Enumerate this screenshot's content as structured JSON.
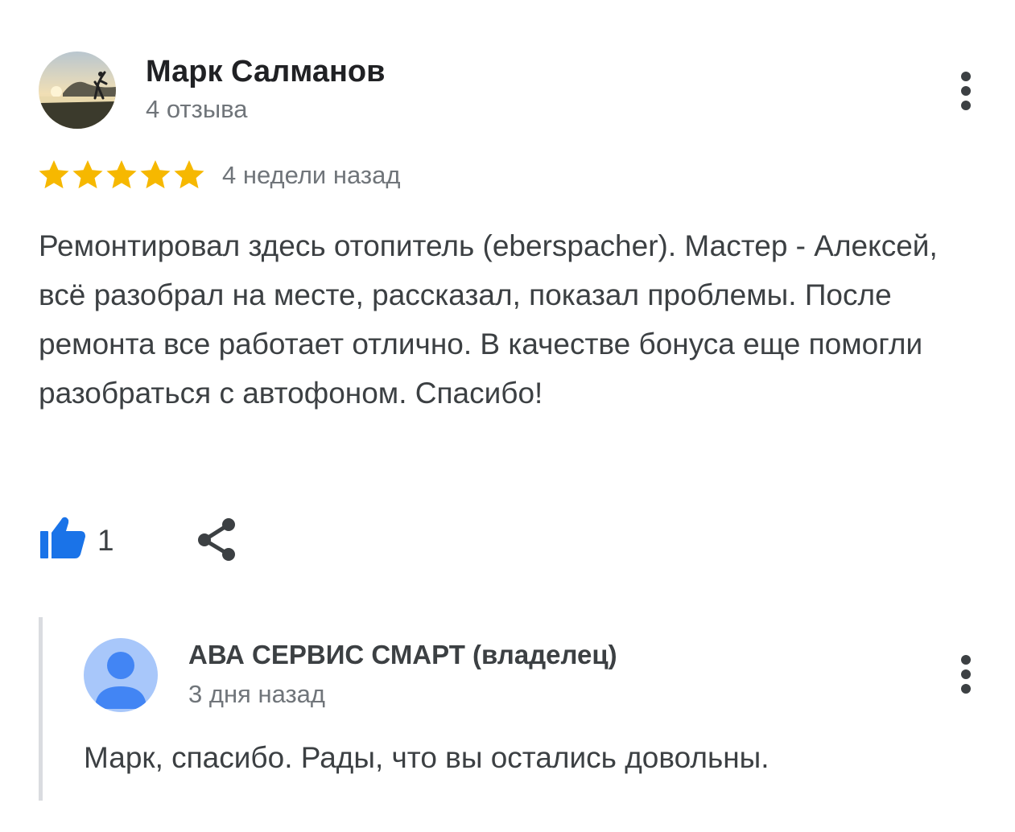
{
  "review": {
    "author": {
      "name": "Марк Салманов",
      "review_count": "4 отзыва",
      "avatar_icon": "user-photo-avatar"
    },
    "rating": 5,
    "rating_max": 5,
    "star_color": "#f6b800",
    "date": "4 недели назад",
    "text": "Ремонтировал здесь отопитель (eberspacher). Мастер - Алексей, всё разобрал на месте, рассказал, показал проблемы. После ремонта все работает отлично. В качестве бонуса еще помогли разобраться с автофоном. Спасибо!",
    "actions": {
      "like_icon": "thumbs-up-icon",
      "like_color": "#1a73e8",
      "like_count": "1",
      "share_icon": "share-icon",
      "more_icon": "more-vertical-icon"
    }
  },
  "owner_reply": {
    "name": "АВА СЕРВИС СМАРТ (владелец)",
    "date": "3 дня назад",
    "text": "Марк, спасибо. Рады, что вы остались довольны.",
    "avatar_icon": "default-user-avatar",
    "avatar_bg": "#a8c7fa",
    "avatar_fg": "#4285f4",
    "more_icon": "more-vertical-icon"
  }
}
